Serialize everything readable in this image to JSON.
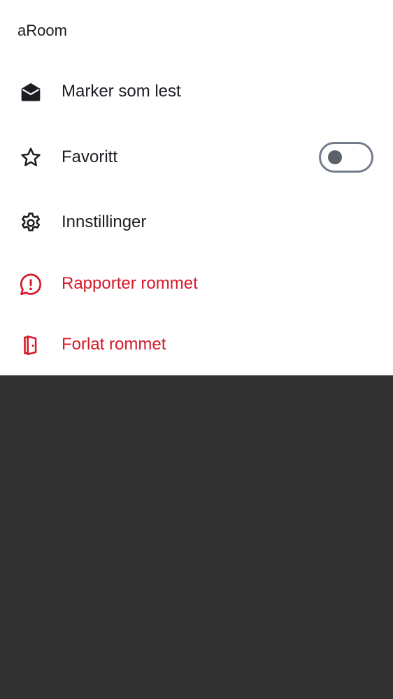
{
  "sheet": {
    "title": "aRoom"
  },
  "menu": {
    "mark_read": {
      "label": "Marker som lest",
      "icon": "envelope-open-icon"
    },
    "favourite": {
      "label": "Favoritt",
      "icon": "star-icon",
      "toggle_on": false
    },
    "settings": {
      "label": "Innstillinger",
      "icon": "gear-icon"
    },
    "report": {
      "label": "Rapporter rommet",
      "icon": "report-icon"
    },
    "leave": {
      "label": "Forlat rommet",
      "icon": "door-exit-icon"
    }
  },
  "colors": {
    "text": "#1b1d22",
    "danger": "#d51928",
    "toggle_border": "#737d8c",
    "toggle_knob": "#5a6169",
    "scrim": "#323232"
  }
}
